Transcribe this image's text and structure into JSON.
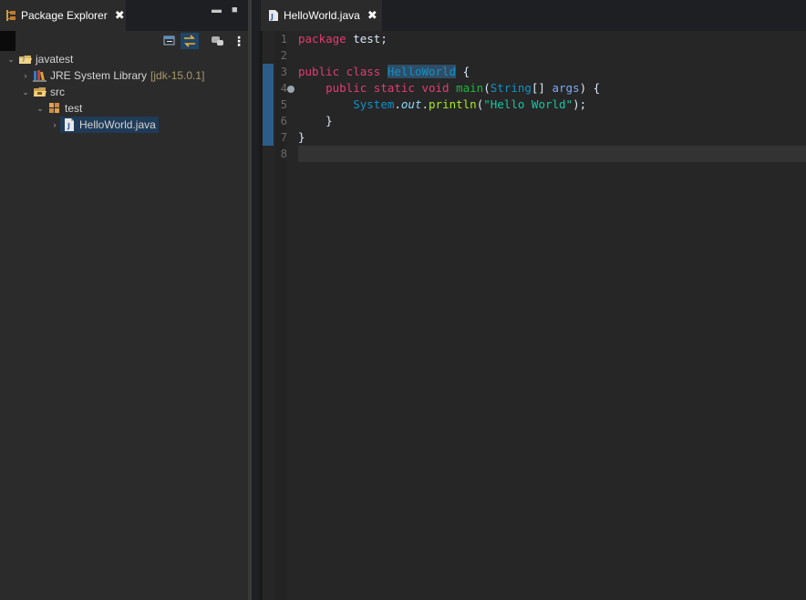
{
  "package_explorer": {
    "tab_title": "Package Explorer",
    "close_glyph": "✖",
    "minimize_glyph": "▬",
    "maximize_glyph": "■",
    "menu_glyph": "⋮",
    "tree": [
      {
        "label": "javatest",
        "icon": "java-project-icon",
        "expanded": true
      },
      {
        "label": "JRE System Library",
        "decoration": "[jdk-15.0.1]",
        "icon": "library-icon",
        "expanded": false
      },
      {
        "label": "src",
        "icon": "source-folder-icon",
        "expanded": true
      },
      {
        "label": "test",
        "icon": "package-icon",
        "expanded": true
      },
      {
        "label": "HelloWorld.java",
        "icon": "java-file-icon",
        "expanded": false,
        "selected": true
      }
    ]
  },
  "editor": {
    "tab_title": "HelloWorld.java",
    "close_glyph": "✖",
    "line_numbers": [
      "1",
      "2",
      "3",
      "4",
      "5",
      "6",
      "7",
      "8"
    ],
    "code": {
      "l1_kw": "package",
      "l1_rest": " test;",
      "l3_kw": "public class",
      "l3_cls": "HelloWorld",
      "l3_rest": " {",
      "l4_indent": "    ",
      "l4_kw": "public static void",
      "l4_meth": "main",
      "l4_paren": "(",
      "l4_type": "String",
      "l4_arr": "[] ",
      "l4_param": "args",
      "l4_rest": ") {",
      "l5_indent": "        ",
      "l5_cls": "System",
      "l5_dot": ".",
      "l5_field": "out",
      "l5_dot2": ".",
      "l5_meth": "println",
      "l5_open": "(",
      "l5_str": "\"Hello World\"",
      "l5_close": ");",
      "l6": "    }",
      "l7": "}"
    }
  },
  "colors": {
    "keyword": "#cc6c9a",
    "class": "#1290c3",
    "method": "#1eb540",
    "string": "#17c6a3",
    "selection": "#1f3b57"
  }
}
